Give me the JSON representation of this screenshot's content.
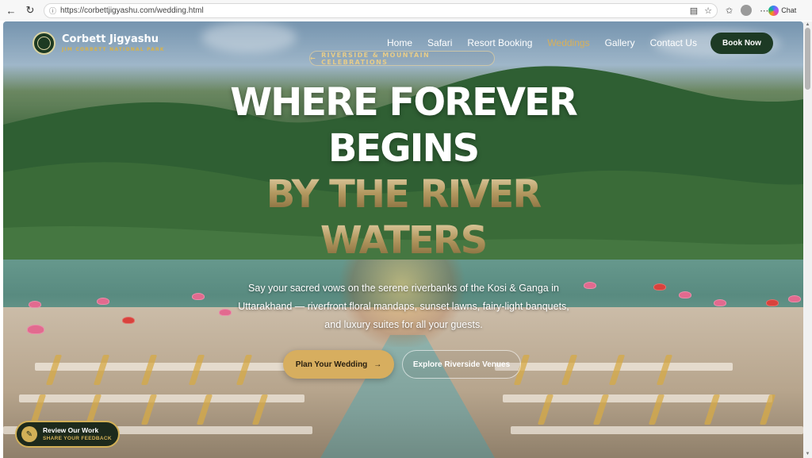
{
  "browser": {
    "url": "https://corbettjigyashu.com/wedding.html",
    "chat_label": "Chat",
    "icons": [
      "back-icon",
      "reload-icon",
      "site-info-icon",
      "reader-icon",
      "favorite-star-icon",
      "favorites-icon",
      "profile-avatar",
      "more-icon",
      "copilot-icon"
    ]
  },
  "header": {
    "brand_name": "Corbett Jigyashu",
    "brand_sub": "JIM CORBETT NATIONAL PARK",
    "nav": [
      {
        "label": "Home",
        "active": false
      },
      {
        "label": "Safari",
        "active": false
      },
      {
        "label": "Resort Booking",
        "active": false
      },
      {
        "label": "Weddings",
        "active": true
      },
      {
        "label": "Gallery",
        "active": false
      },
      {
        "label": "Contact Us",
        "active": false
      }
    ],
    "book_now": "Book Now"
  },
  "hero": {
    "tag": "RIVERSIDE & MOUNTAIN CELEBRATIONS",
    "line1": "WHERE FOREVER",
    "line2": "BEGINS",
    "line3": "BY THE RIVER",
    "line4": "WATERS",
    "subtitle": "Say your sacred vows on the serene riverbanks of the Kosi & Ganga in Uttarakhand — riverfront floral mandaps, sunset lawns, fairy-light banquets, and luxury suites for all your guests.",
    "cta_primary": "Plan Your Wedding",
    "cta_secondary": "Explore Riverside Venues"
  },
  "review": {
    "title": "Review Our Work",
    "sub": "SHARE YOUR FEEDBACK"
  },
  "colors": {
    "accent_gold": "#d7ae5f",
    "brand_green": "#1d3a24",
    "active_nav": "#d8b05a"
  }
}
